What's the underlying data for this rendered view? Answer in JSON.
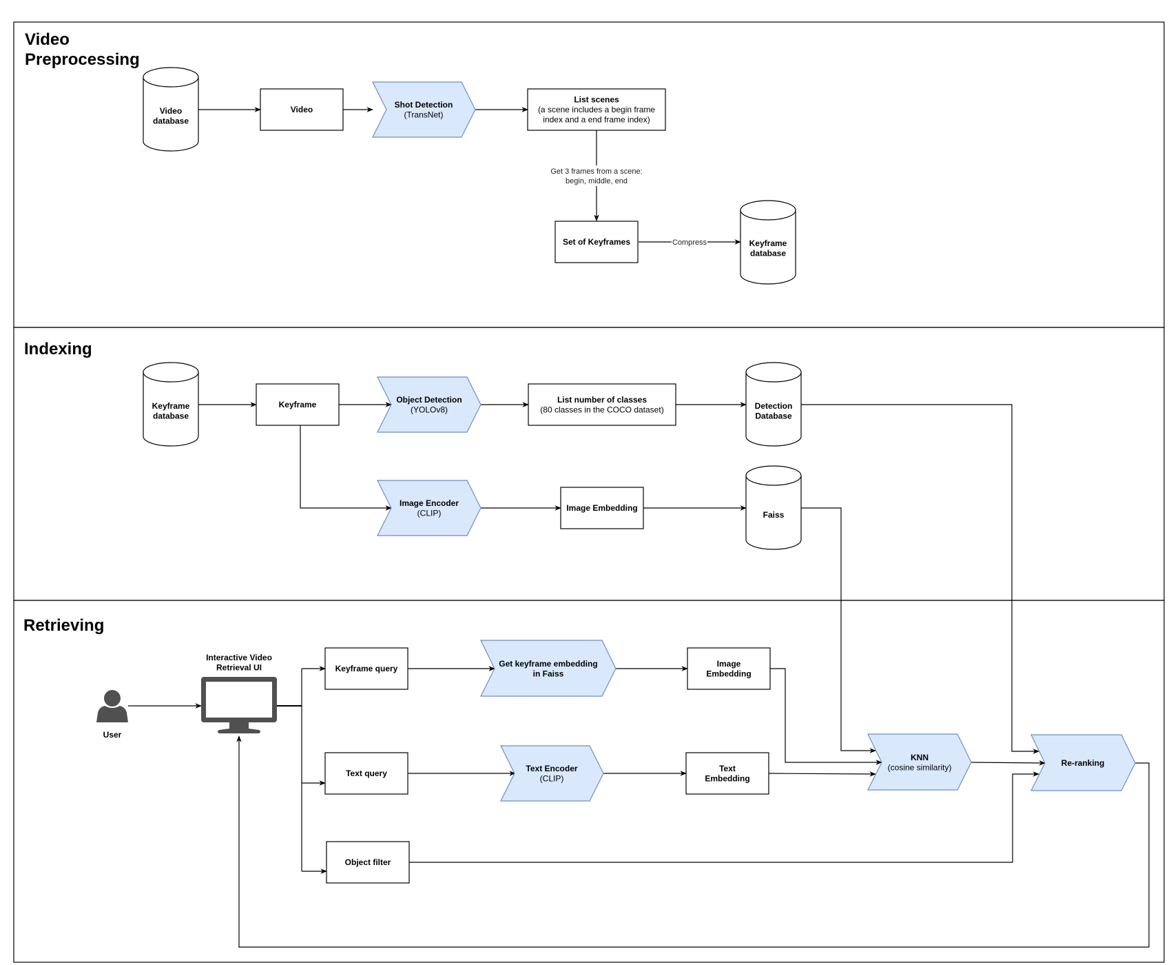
{
  "lanes": [
    {
      "id": "preprocessing",
      "title_lines": [
        "Video",
        "Preprocessing"
      ]
    },
    {
      "id": "indexing",
      "title_lines": [
        "Indexing"
      ]
    },
    {
      "id": "retrieving",
      "title_lines": [
        "Retrieving"
      ]
    }
  ],
  "nodes": {
    "video_database": {
      "lines": [
        {
          "t": "Video",
          "b": true
        },
        {
          "t": "database",
          "b": true
        }
      ]
    },
    "video": {
      "lines": [
        {
          "t": "Video",
          "b": true
        }
      ]
    },
    "shot_detection": {
      "lines": [
        {
          "t": "Shot Detection",
          "b": true
        },
        {
          "t": "(TransNet)",
          "b": false
        }
      ]
    },
    "list_scenes": {
      "lines": [
        {
          "t": "List scenes",
          "b": true
        },
        {
          "t": "(a scene includes a begin frame",
          "b": false
        },
        {
          "t": "index and a end frame index)",
          "b": false
        }
      ]
    },
    "set_of_keyframes": {
      "lines": [
        {
          "t": "Set of Keyframes",
          "b": true
        }
      ]
    },
    "keyframe_database_1": {
      "lines": [
        {
          "t": "Keyframe",
          "b": true
        },
        {
          "t": "database",
          "b": true
        }
      ]
    },
    "keyframe_database_2": {
      "lines": [
        {
          "t": "Keyframe",
          "b": true
        },
        {
          "t": "database",
          "b": true
        }
      ]
    },
    "keyframe": {
      "lines": [
        {
          "t": "Keyframe",
          "b": true
        }
      ]
    },
    "object_detection": {
      "lines": [
        {
          "t": "Object Detection",
          "b": true
        },
        {
          "t": "(YOLOv8)",
          "b": false
        }
      ]
    },
    "list_classes": {
      "lines": [
        {
          "t": "List number of classes",
          "b": true
        },
        {
          "t": "(80 classes in the COCO dataset)",
          "b": false
        }
      ]
    },
    "detection_database": {
      "lines": [
        {
          "t": "Detection",
          "b": true
        },
        {
          "t": "Database",
          "b": true
        }
      ]
    },
    "image_encoder": {
      "lines": [
        {
          "t": "Image Encoder",
          "b": true
        },
        {
          "t": "(CLIP)",
          "b": false
        }
      ]
    },
    "image_embedding_idx": {
      "lines": [
        {
          "t": "Image Embedding",
          "b": true
        }
      ]
    },
    "faiss": {
      "lines": [
        {
          "t": "Faiss",
          "b": true
        }
      ]
    },
    "user": {
      "lines": [
        {
          "t": "User",
          "b": true
        }
      ]
    },
    "ui": {
      "lines": [
        {
          "t": "Interactive Video",
          "b": true
        },
        {
          "t": "Retrieval UI",
          "b": true
        }
      ]
    },
    "keyframe_query": {
      "lines": [
        {
          "t": "Keyframe query",
          "b": true
        }
      ]
    },
    "get_keyframe_embedding": {
      "lines": [
        {
          "t": "Get keyframe embedding",
          "b": true
        },
        {
          "t": "in Faiss",
          "b": true
        }
      ]
    },
    "image_embedding_ret": {
      "lines": [
        {
          "t": "Image",
          "b": true
        },
        {
          "t": "Embedding",
          "b": true
        }
      ]
    },
    "text_query": {
      "lines": [
        {
          "t": "Text query",
          "b": true
        }
      ]
    },
    "text_encoder": {
      "lines": [
        {
          "t": "Text Encoder",
          "b": true
        },
        {
          "t": "(CLIP)",
          "b": false
        }
      ]
    },
    "text_embedding": {
      "lines": [
        {
          "t": "Text",
          "b": true
        },
        {
          "t": "Embedding",
          "b": true
        }
      ]
    },
    "object_filter": {
      "lines": [
        {
          "t": "Object filter",
          "b": true
        }
      ]
    },
    "knn": {
      "lines": [
        {
          "t": "KNN",
          "b": true
        },
        {
          "t": "(cosine similarity)",
          "b": false
        }
      ]
    },
    "reranking": {
      "lines": [
        {
          "t": "Re-ranking",
          "b": true
        }
      ]
    }
  },
  "edge_labels": {
    "scenes_to_keyframes": [
      "Get 3 frames from a scene:",
      "begin, middle, end"
    ],
    "keyframes_to_db": [
      "Compress"
    ]
  },
  "colors": {
    "process_fill": "#dae8fc",
    "process_stroke": "#6c8ebf",
    "icon_gray": "#505050"
  }
}
